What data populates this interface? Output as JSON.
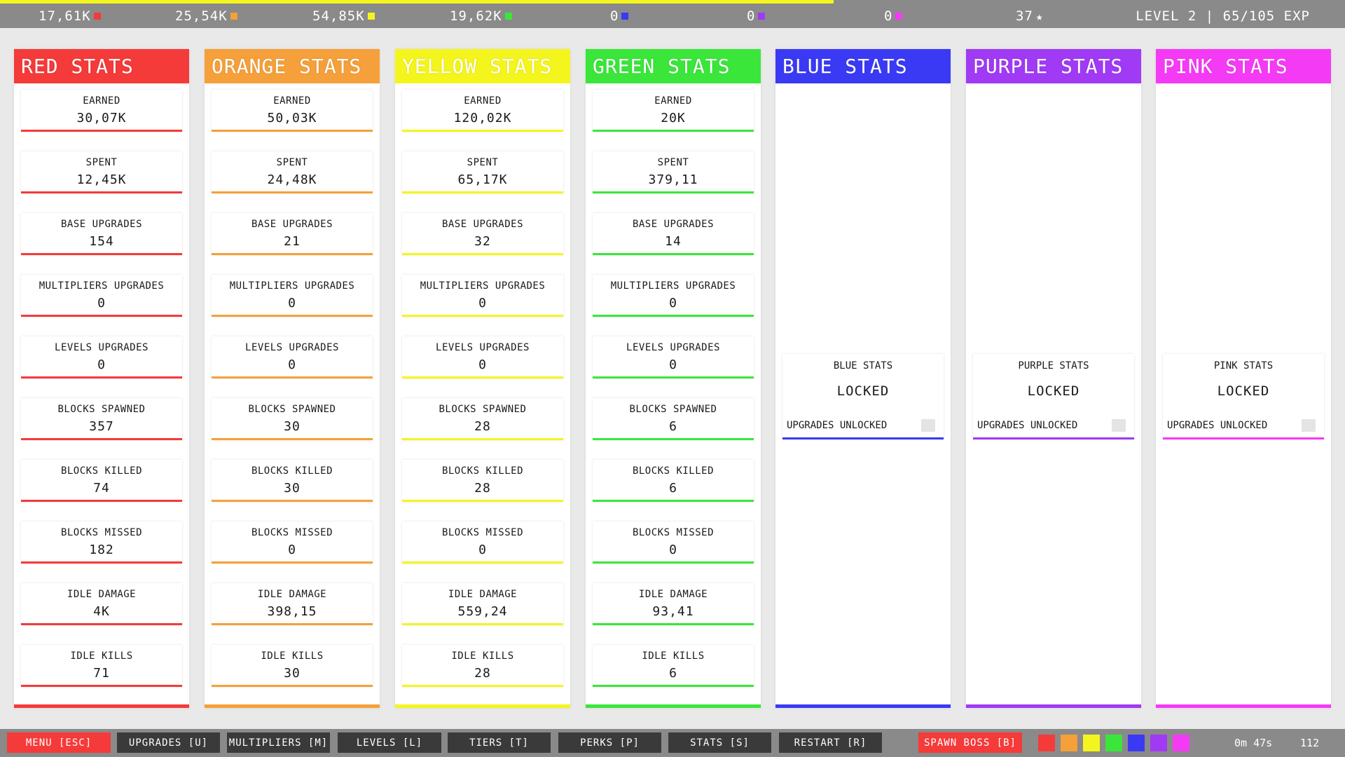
{
  "topbar": {
    "xp_fraction": 0.62,
    "resources": [
      {
        "value": "17,61K",
        "color": "#f53a3a"
      },
      {
        "value": "25,54K",
        "color": "#f5a03a"
      },
      {
        "value": "54,85K",
        "color": "#f5f51e"
      },
      {
        "value": "19,62K",
        "color": "#3ae63a"
      },
      {
        "value": "0",
        "color": "#3a3af5"
      },
      {
        "value": "0",
        "color": "#a03af5"
      },
      {
        "value": "0",
        "color": "#f53af5"
      }
    ],
    "stars": "37",
    "star_icon": "★",
    "level_text": "LEVEL 2 | 65/105 EXP"
  },
  "columns": [
    {
      "title": "RED STATS",
      "color": "#f53a3a",
      "locked": false,
      "stats": [
        {
          "label": "EARNED",
          "value": "30,07K"
        },
        {
          "label": "SPENT",
          "value": "12,45K"
        },
        {
          "label": "BASE UPGRADES",
          "value": "154"
        },
        {
          "label": "MULTIPLIERS UPGRADES",
          "value": "0"
        },
        {
          "label": "LEVELS UPGRADES",
          "value": "0"
        },
        {
          "label": "BLOCKS SPAWNED",
          "value": "357"
        },
        {
          "label": "BLOCKS KILLED",
          "value": "74"
        },
        {
          "label": "BLOCKS MISSED",
          "value": "182"
        },
        {
          "label": "IDLE DAMAGE",
          "value": "4K"
        },
        {
          "label": "IDLE KILLS",
          "value": "71"
        }
      ]
    },
    {
      "title": "ORANGE STATS",
      "color": "#f5a03a",
      "locked": false,
      "stats": [
        {
          "label": "EARNED",
          "value": "50,03K"
        },
        {
          "label": "SPENT",
          "value": "24,48K"
        },
        {
          "label": "BASE UPGRADES",
          "value": "21"
        },
        {
          "label": "MULTIPLIERS UPGRADES",
          "value": "0"
        },
        {
          "label": "LEVELS UPGRADES",
          "value": "0"
        },
        {
          "label": "BLOCKS SPAWNED",
          "value": "30"
        },
        {
          "label": "BLOCKS KILLED",
          "value": "30"
        },
        {
          "label": "BLOCKS MISSED",
          "value": "0"
        },
        {
          "label": "IDLE DAMAGE",
          "value": "398,15"
        },
        {
          "label": "IDLE KILLS",
          "value": "30"
        }
      ]
    },
    {
      "title": "YELLOW STATS",
      "color": "#f5f51e",
      "locked": false,
      "stats": [
        {
          "label": "EARNED",
          "value": "120,02K"
        },
        {
          "label": "SPENT",
          "value": "65,17K"
        },
        {
          "label": "BASE UPGRADES",
          "value": "32"
        },
        {
          "label": "MULTIPLIERS UPGRADES",
          "value": "0"
        },
        {
          "label": "LEVELS UPGRADES",
          "value": "0"
        },
        {
          "label": "BLOCKS SPAWNED",
          "value": "28"
        },
        {
          "label": "BLOCKS KILLED",
          "value": "28"
        },
        {
          "label": "BLOCKS MISSED",
          "value": "0"
        },
        {
          "label": "IDLE DAMAGE",
          "value": "559,24"
        },
        {
          "label": "IDLE KILLS",
          "value": "28"
        }
      ]
    },
    {
      "title": "GREEN STATS",
      "color": "#3ae63a",
      "locked": false,
      "stats": [
        {
          "label": "EARNED",
          "value": "20K"
        },
        {
          "label": "SPENT",
          "value": "379,11"
        },
        {
          "label": "BASE UPGRADES",
          "value": "14"
        },
        {
          "label": "MULTIPLIERS UPGRADES",
          "value": "0"
        },
        {
          "label": "LEVELS UPGRADES",
          "value": "0"
        },
        {
          "label": "BLOCKS SPAWNED",
          "value": "6"
        },
        {
          "label": "BLOCKS KILLED",
          "value": "6"
        },
        {
          "label": "BLOCKS MISSED",
          "value": "0"
        },
        {
          "label": "IDLE DAMAGE",
          "value": "93,41"
        },
        {
          "label": "IDLE KILLS",
          "value": "6"
        }
      ]
    },
    {
      "title": "BLUE STATS",
      "color": "#3a3af5",
      "locked": true,
      "locked_title": "BLUE STATS",
      "locked_text": "LOCKED",
      "unlock_label": "UPGRADES UNLOCKED"
    },
    {
      "title": "PURPLE STATS",
      "color": "#a03af5",
      "locked": true,
      "locked_title": "PURPLE STATS",
      "locked_text": "LOCKED",
      "unlock_label": "UPGRADES UNLOCKED"
    },
    {
      "title": "PINK STATS",
      "color": "#f53af5",
      "locked": true,
      "locked_title": "PINK STATS",
      "locked_text": "LOCKED",
      "unlock_label": "UPGRADES UNLOCKED"
    }
  ],
  "bottombar": {
    "buttons": [
      {
        "label": "MENU [ESC]",
        "name": "menu-button",
        "style": "menu"
      },
      {
        "label": "UPGRADES [U]",
        "name": "upgrades-button",
        "style": "normal"
      },
      {
        "label": "MULTIPLIERS [M]",
        "name": "multipliers-button",
        "style": "normal"
      },
      {
        "label": "LEVELS [L]",
        "name": "levels-button",
        "style": "normal"
      },
      {
        "label": "TIERS [T]",
        "name": "tiers-button",
        "style": "normal"
      },
      {
        "label": "PERKS [P]",
        "name": "perks-button",
        "style": "normal"
      },
      {
        "label": "STATS [S]",
        "name": "stats-button",
        "style": "normal"
      },
      {
        "label": "RESTART [R]",
        "name": "restart-button",
        "style": "normal"
      },
      {
        "label": "SPAWN BOSS [B]",
        "name": "spawn-boss-button",
        "style": "boss"
      }
    ],
    "color_swatches": [
      "#f53a3a",
      "#f5a03a",
      "#f5f51e",
      "#3ae63a",
      "#3a3af5",
      "#a03af5",
      "#f53af5"
    ],
    "timer": "0m 47s",
    "fps": "112"
  }
}
